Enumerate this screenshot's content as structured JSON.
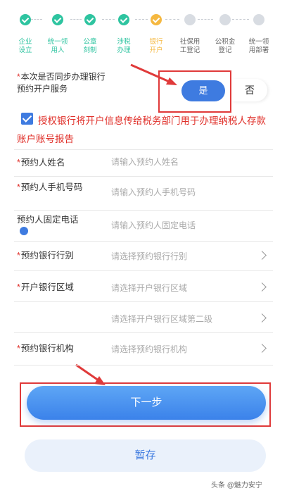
{
  "steps": [
    {
      "label": "企业\n设立",
      "status": "done"
    },
    {
      "label": "统一领\n用人",
      "status": "done"
    },
    {
      "label": "公章\n刻制",
      "status": "done"
    },
    {
      "label": "涉税\n办理",
      "status": "done"
    },
    {
      "label": "银行\n开户",
      "status": "active"
    },
    {
      "label": "社保用\n工登记",
      "status": "todo"
    },
    {
      "label": "公积金\n登记",
      "status": "todo"
    },
    {
      "label": "统一领\n用部署",
      "status": "todo"
    }
  ],
  "sync": {
    "question": "本次是否同步办理银行预约开户服务",
    "yes": "是",
    "no": "否"
  },
  "consent": {
    "text": "授权银行将开户信息传给税务部门用于办理纳税人存款账户账号报告",
    "checked": true
  },
  "form": {
    "name_label": "预约人姓名",
    "name_placeholder": "请输入预约人姓名",
    "phone_label": "预约人手机号码",
    "phone_placeholder": "请输入预约人手机号码",
    "landline_label": "预约人固定电话",
    "landline_placeholder": "请输入预约人固定电话",
    "bank_type_label": "预约银行行别",
    "bank_type_placeholder": "请选择预约银行行别",
    "region_label": "开户银行区域",
    "region_placeholder": "请选择开户银行区域",
    "region2_placeholder": "请选择开户银行区域第二级",
    "institution_label": "预约银行机构",
    "institution_placeholder": "请选择预约银行机构"
  },
  "buttons": {
    "next": "下一步",
    "save": "暂存"
  },
  "watermark": "头条 @魅力安宁",
  "colors": {
    "accent": "#3e7be0",
    "done": "#2ec4a0",
    "active": "#f5b840",
    "highlight": "#e03a3a"
  }
}
